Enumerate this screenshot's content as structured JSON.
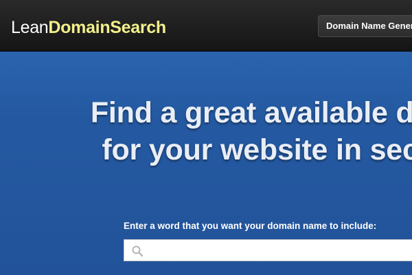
{
  "header": {
    "logo_lean": "Lean",
    "logo_domainsearch": "DomainSearch",
    "nav_button_label": "Domain Name Generator"
  },
  "hero": {
    "headline_line1": "Find a great available domain",
    "headline_line2": "for your website in seconds"
  },
  "search": {
    "label": "Enter a word that you want your domain name to include:",
    "value": "",
    "placeholder": ""
  },
  "icons": {
    "search": "search-icon"
  },
  "colors": {
    "header_bg": "#1c1c1c",
    "logo_accent": "#f2f08a",
    "hero_bg": "#2459a1",
    "headline_text": "#e9eef6"
  }
}
